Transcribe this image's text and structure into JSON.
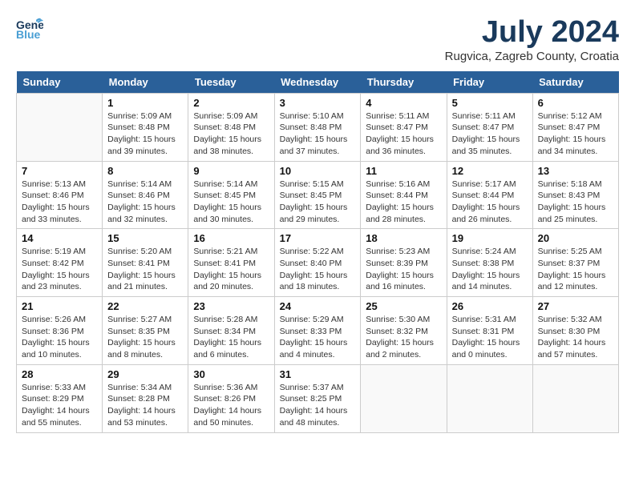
{
  "header": {
    "logo_general": "General",
    "logo_blue": "Blue",
    "month_year": "July 2024",
    "location": "Rugvica, Zagreb County, Croatia"
  },
  "days_of_week": [
    "Sunday",
    "Monday",
    "Tuesday",
    "Wednesday",
    "Thursday",
    "Friday",
    "Saturday"
  ],
  "weeks": [
    [
      {
        "day": "",
        "info": ""
      },
      {
        "day": "1",
        "info": "Sunrise: 5:09 AM\nSunset: 8:48 PM\nDaylight: 15 hours\nand 39 minutes."
      },
      {
        "day": "2",
        "info": "Sunrise: 5:09 AM\nSunset: 8:48 PM\nDaylight: 15 hours\nand 38 minutes."
      },
      {
        "day": "3",
        "info": "Sunrise: 5:10 AM\nSunset: 8:48 PM\nDaylight: 15 hours\nand 37 minutes."
      },
      {
        "day": "4",
        "info": "Sunrise: 5:11 AM\nSunset: 8:47 PM\nDaylight: 15 hours\nand 36 minutes."
      },
      {
        "day": "5",
        "info": "Sunrise: 5:11 AM\nSunset: 8:47 PM\nDaylight: 15 hours\nand 35 minutes."
      },
      {
        "day": "6",
        "info": "Sunrise: 5:12 AM\nSunset: 8:47 PM\nDaylight: 15 hours\nand 34 minutes."
      }
    ],
    [
      {
        "day": "7",
        "info": "Sunrise: 5:13 AM\nSunset: 8:46 PM\nDaylight: 15 hours\nand 33 minutes."
      },
      {
        "day": "8",
        "info": "Sunrise: 5:14 AM\nSunset: 8:46 PM\nDaylight: 15 hours\nand 32 minutes."
      },
      {
        "day": "9",
        "info": "Sunrise: 5:14 AM\nSunset: 8:45 PM\nDaylight: 15 hours\nand 30 minutes."
      },
      {
        "day": "10",
        "info": "Sunrise: 5:15 AM\nSunset: 8:45 PM\nDaylight: 15 hours\nand 29 minutes."
      },
      {
        "day": "11",
        "info": "Sunrise: 5:16 AM\nSunset: 8:44 PM\nDaylight: 15 hours\nand 28 minutes."
      },
      {
        "day": "12",
        "info": "Sunrise: 5:17 AM\nSunset: 8:44 PM\nDaylight: 15 hours\nand 26 minutes."
      },
      {
        "day": "13",
        "info": "Sunrise: 5:18 AM\nSunset: 8:43 PM\nDaylight: 15 hours\nand 25 minutes."
      }
    ],
    [
      {
        "day": "14",
        "info": "Sunrise: 5:19 AM\nSunset: 8:42 PM\nDaylight: 15 hours\nand 23 minutes."
      },
      {
        "day": "15",
        "info": "Sunrise: 5:20 AM\nSunset: 8:41 PM\nDaylight: 15 hours\nand 21 minutes."
      },
      {
        "day": "16",
        "info": "Sunrise: 5:21 AM\nSunset: 8:41 PM\nDaylight: 15 hours\nand 20 minutes."
      },
      {
        "day": "17",
        "info": "Sunrise: 5:22 AM\nSunset: 8:40 PM\nDaylight: 15 hours\nand 18 minutes."
      },
      {
        "day": "18",
        "info": "Sunrise: 5:23 AM\nSunset: 8:39 PM\nDaylight: 15 hours\nand 16 minutes."
      },
      {
        "day": "19",
        "info": "Sunrise: 5:24 AM\nSunset: 8:38 PM\nDaylight: 15 hours\nand 14 minutes."
      },
      {
        "day": "20",
        "info": "Sunrise: 5:25 AM\nSunset: 8:37 PM\nDaylight: 15 hours\nand 12 minutes."
      }
    ],
    [
      {
        "day": "21",
        "info": "Sunrise: 5:26 AM\nSunset: 8:36 PM\nDaylight: 15 hours\nand 10 minutes."
      },
      {
        "day": "22",
        "info": "Sunrise: 5:27 AM\nSunset: 8:35 PM\nDaylight: 15 hours\nand 8 minutes."
      },
      {
        "day": "23",
        "info": "Sunrise: 5:28 AM\nSunset: 8:34 PM\nDaylight: 15 hours\nand 6 minutes."
      },
      {
        "day": "24",
        "info": "Sunrise: 5:29 AM\nSunset: 8:33 PM\nDaylight: 15 hours\nand 4 minutes."
      },
      {
        "day": "25",
        "info": "Sunrise: 5:30 AM\nSunset: 8:32 PM\nDaylight: 15 hours\nand 2 minutes."
      },
      {
        "day": "26",
        "info": "Sunrise: 5:31 AM\nSunset: 8:31 PM\nDaylight: 15 hours\nand 0 minutes."
      },
      {
        "day": "27",
        "info": "Sunrise: 5:32 AM\nSunset: 8:30 PM\nDaylight: 14 hours\nand 57 minutes."
      }
    ],
    [
      {
        "day": "28",
        "info": "Sunrise: 5:33 AM\nSunset: 8:29 PM\nDaylight: 14 hours\nand 55 minutes."
      },
      {
        "day": "29",
        "info": "Sunrise: 5:34 AM\nSunset: 8:28 PM\nDaylight: 14 hours\nand 53 minutes."
      },
      {
        "day": "30",
        "info": "Sunrise: 5:36 AM\nSunset: 8:26 PM\nDaylight: 14 hours\nand 50 minutes."
      },
      {
        "day": "31",
        "info": "Sunrise: 5:37 AM\nSunset: 8:25 PM\nDaylight: 14 hours\nand 48 minutes."
      },
      {
        "day": "",
        "info": ""
      },
      {
        "day": "",
        "info": ""
      },
      {
        "day": "",
        "info": ""
      }
    ]
  ]
}
